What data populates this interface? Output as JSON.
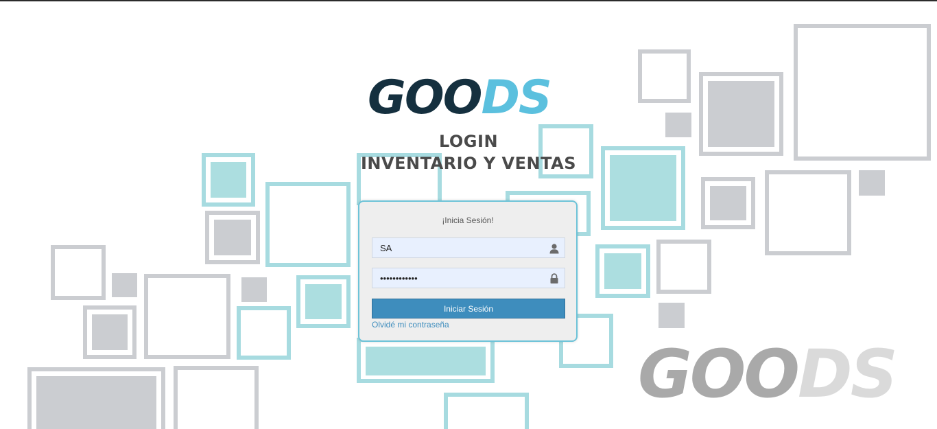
{
  "brand": {
    "name_part1": "GOO",
    "name_part2": "DS",
    "colors": {
      "dark": "#15303f",
      "accent": "#5bc0de",
      "grey": "#a9a9a9",
      "grey_light": "#dadada"
    }
  },
  "header": {
    "line1": "LOGIN",
    "line2": "INVENTARIO Y VENTAS"
  },
  "login": {
    "heading": "¡Inicia Sesión!",
    "username_value": "SA",
    "password_value": "••••••••••••",
    "submit_label": "Iniciar Sesión",
    "forgot_label": "Olvidé mi contraseña"
  },
  "icons": {
    "username": "user-icon",
    "password": "lock-icon"
  }
}
